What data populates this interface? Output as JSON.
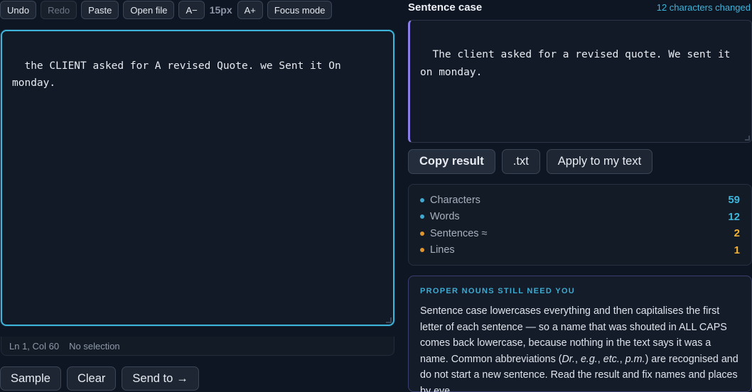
{
  "toolbar": {
    "undo": "Undo",
    "redo": "Redo",
    "paste": "Paste",
    "open_file": "Open file",
    "font_decrease": "A−",
    "font_size": "15px",
    "font_increase": "A+",
    "focus_mode": "Focus mode"
  },
  "editor": {
    "text": "the CLIENT asked for A revised Quote. we Sent it On\nmonday."
  },
  "status": {
    "position": "Ln 1, Col 60",
    "selection": "No selection"
  },
  "bottom_actions": {
    "sample": "Sample",
    "clear": "Clear",
    "send_to": "Send to",
    "send_arrow": "→"
  },
  "result": {
    "title": "Sentence case",
    "changed": "12 characters changed",
    "text": "The client asked for a revised quote. We sent it\non monday."
  },
  "result_actions": {
    "copy": "Copy result",
    "txt": ".txt",
    "apply": "Apply to my text"
  },
  "stats": [
    {
      "label": "Characters",
      "value": "59",
      "color": "cyan"
    },
    {
      "label": "Words",
      "value": "12",
      "color": "cyan"
    },
    {
      "label": "Sentences ≈",
      "value": "2",
      "color": "amber"
    },
    {
      "label": "Lines",
      "value": "1",
      "color": "amber"
    }
  ],
  "note": {
    "title": "PROPER NOUNS STILL NEED YOU",
    "body_1": "Sentence case lowercases everything and then capitalises the first letter of each sentence — so a name that was shouted in ALL CAPS comes back lowercase, because nothing in the text says it was a name. Common abbreviations (",
    "abbr_1": "Dr.",
    "sep_1": ", ",
    "abbr_2": "e.g.",
    "sep_2": ", ",
    "abbr_3": "etc.",
    "sep_3": ", ",
    "abbr_4": "p.m.",
    "body_2": ") are recognised and do not start a new sentence. Read the result and fix names and places by eye."
  },
  "colors": {
    "accent": "#3fb5dc",
    "amber": "#f2b236",
    "purple": "#8b7ee8",
    "background": "#0f1623"
  }
}
